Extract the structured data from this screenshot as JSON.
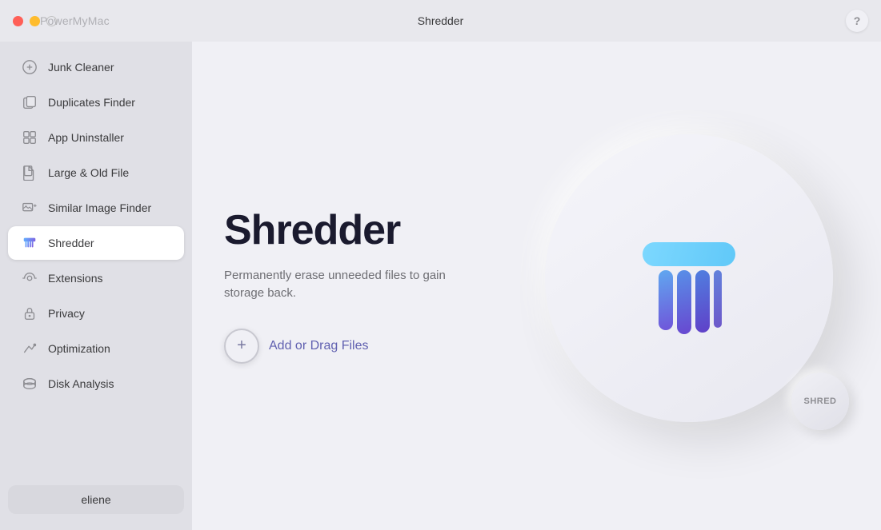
{
  "titlebar": {
    "app_name": "PowerMyMac",
    "window_title": "Shredder",
    "help_label": "?"
  },
  "sidebar": {
    "items": [
      {
        "id": "junk-cleaner",
        "label": "Junk Cleaner",
        "active": false,
        "icon": "junk"
      },
      {
        "id": "duplicates-finder",
        "label": "Duplicates Finder",
        "active": false,
        "icon": "duplicates"
      },
      {
        "id": "app-uninstaller",
        "label": "App Uninstaller",
        "active": false,
        "icon": "app-uninstaller"
      },
      {
        "id": "large-old-file",
        "label": "Large & Old File",
        "active": false,
        "icon": "large-file"
      },
      {
        "id": "similar-image-finder",
        "label": "Similar Image Finder",
        "active": false,
        "icon": "similar-image"
      },
      {
        "id": "shredder",
        "label": "Shredder",
        "active": true,
        "icon": "shredder"
      },
      {
        "id": "extensions",
        "label": "Extensions",
        "active": false,
        "icon": "extensions"
      },
      {
        "id": "privacy",
        "label": "Privacy",
        "active": false,
        "icon": "privacy"
      },
      {
        "id": "optimization",
        "label": "Optimization",
        "active": false,
        "icon": "optimization"
      },
      {
        "id": "disk-analysis",
        "label": "Disk Analysis",
        "active": false,
        "icon": "disk-analysis"
      }
    ],
    "footer": {
      "user_label": "eliene"
    }
  },
  "content": {
    "title": "Shredder",
    "description": "Permanently erase unneeded files to gain storage back.",
    "add_files_label": "Add or Drag Files",
    "shred_button_label": "SHRED"
  }
}
